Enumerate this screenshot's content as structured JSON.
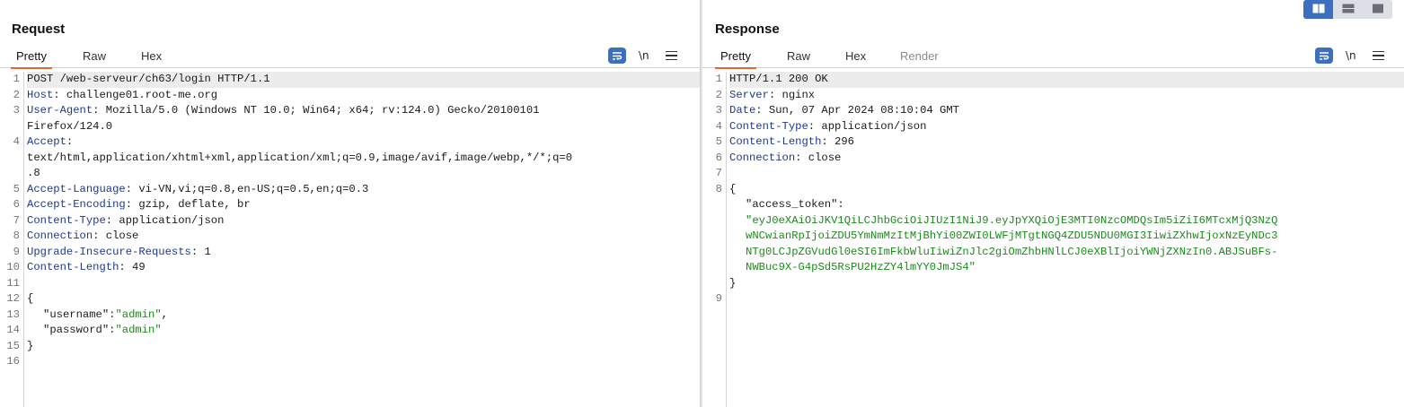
{
  "layout_toggle": {
    "buttons": [
      {
        "name": "side-by-side-layout-button",
        "icon": "columns-icon",
        "active": true
      },
      {
        "name": "stacked-layout-button",
        "icon": "rows-icon",
        "active": false
      },
      {
        "name": "single-layout-button",
        "icon": "square-icon",
        "active": false
      }
    ]
  },
  "request": {
    "title": "Request",
    "tabs": [
      "Pretty",
      "Raw",
      "Hex"
    ],
    "active_tab": "Pretty",
    "tools": {
      "wrap_icon": "wrap-text-icon",
      "newline_label": "\\n",
      "menu_icon": "hamburger-menu-icon"
    },
    "lines": [
      {
        "n": "1",
        "parts": [
          {
            "t": "POST /web-serveur/ch63/login HTTP/1.1",
            "c": "plain"
          }
        ],
        "highlight": true
      },
      {
        "n": "2",
        "parts": [
          {
            "t": "Host",
            "c": "hn"
          },
          {
            "t": ": challenge01.root-me.org",
            "c": "plain"
          }
        ]
      },
      {
        "n": "3",
        "parts": [
          {
            "t": "User-Agent",
            "c": "hn"
          },
          {
            "t": ": Mozilla/5.0 (Windows NT 10.0; Win64; x64; rv:124.0) Gecko/20100101",
            "c": "plain"
          }
        ]
      },
      {
        "n": "",
        "parts": [
          {
            "t": "Firefox/124.0",
            "c": "plain"
          }
        ]
      },
      {
        "n": "4",
        "parts": [
          {
            "t": "Accept",
            "c": "hn"
          },
          {
            "t": ":",
            "c": "plain"
          }
        ]
      },
      {
        "n": "",
        "parts": [
          {
            "t": "text/html,application/xhtml+xml,application/xml;q=0.9,image/avif,image/webp,*/*;q=0",
            "c": "plain"
          }
        ]
      },
      {
        "n": "",
        "parts": [
          {
            "t": ".8",
            "c": "plain"
          }
        ]
      },
      {
        "n": "5",
        "parts": [
          {
            "t": "Accept-Language",
            "c": "hn"
          },
          {
            "t": ": vi-VN,vi;q=0.8,en-US;q=0.5,en;q=0.3",
            "c": "plain"
          }
        ]
      },
      {
        "n": "6",
        "parts": [
          {
            "t": "Accept-Encoding",
            "c": "hn"
          },
          {
            "t": ": gzip, deflate, br",
            "c": "plain"
          }
        ]
      },
      {
        "n": "7",
        "parts": [
          {
            "t": "Content-Type",
            "c": "hn"
          },
          {
            "t": ": application/json",
            "c": "plain"
          }
        ]
      },
      {
        "n": "8",
        "parts": [
          {
            "t": "Connection",
            "c": "hn"
          },
          {
            "t": ": close",
            "c": "plain"
          }
        ]
      },
      {
        "n": "9",
        "parts": [
          {
            "t": "Upgrade-Insecure-Requests",
            "c": "hn"
          },
          {
            "t": ": 1",
            "c": "plain"
          }
        ]
      },
      {
        "n": "10",
        "parts": [
          {
            "t": "Content-Length",
            "c": "hn"
          },
          {
            "t": ": 49",
            "c": "plain"
          }
        ]
      },
      {
        "n": "11",
        "parts": []
      },
      {
        "n": "12",
        "parts": [
          {
            "t": "{",
            "c": "plain"
          }
        ]
      },
      {
        "n": "13",
        "indent": true,
        "parts": [
          {
            "t": "\"username\"",
            "c": "key"
          },
          {
            "t": ":",
            "c": "plain"
          },
          {
            "t": "\"admin\"",
            "c": "str"
          },
          {
            "t": ",",
            "c": "plain"
          }
        ]
      },
      {
        "n": "14",
        "indent": true,
        "parts": [
          {
            "t": "\"password\"",
            "c": "key"
          },
          {
            "t": ":",
            "c": "plain"
          },
          {
            "t": "\"admin\"",
            "c": "str"
          }
        ]
      },
      {
        "n": "15",
        "parts": [
          {
            "t": "}",
            "c": "plain"
          }
        ]
      },
      {
        "n": "16",
        "parts": []
      }
    ]
  },
  "response": {
    "title": "Response",
    "tabs": [
      "Pretty",
      "Raw",
      "Hex",
      "Render"
    ],
    "active_tab": "Pretty",
    "tools": {
      "wrap_icon": "wrap-text-icon",
      "newline_label": "\\n",
      "menu_icon": "hamburger-menu-icon"
    },
    "lines": [
      {
        "n": "1",
        "parts": [
          {
            "t": "HTTP/1.1 200 OK",
            "c": "plain"
          }
        ],
        "highlight": true
      },
      {
        "n": "2",
        "parts": [
          {
            "t": "Server",
            "c": "hn"
          },
          {
            "t": ": nginx",
            "c": "plain"
          }
        ]
      },
      {
        "n": "3",
        "parts": [
          {
            "t": "Date",
            "c": "hn"
          },
          {
            "t": ": Sun, 07 Apr 2024 08:10:04 GMT",
            "c": "plain"
          }
        ]
      },
      {
        "n": "4",
        "parts": [
          {
            "t": "Content-Type",
            "c": "hn"
          },
          {
            "t": ": application/json",
            "c": "plain"
          }
        ]
      },
      {
        "n": "5",
        "parts": [
          {
            "t": "Content-Length",
            "c": "hn"
          },
          {
            "t": ": 296",
            "c": "plain"
          }
        ]
      },
      {
        "n": "6",
        "parts": [
          {
            "t": "Connection",
            "c": "hn"
          },
          {
            "t": ": close",
            "c": "plain"
          }
        ]
      },
      {
        "n": "7",
        "parts": []
      },
      {
        "n": "8",
        "parts": [
          {
            "t": "{",
            "c": "plain"
          }
        ]
      },
      {
        "n": "",
        "indent": true,
        "parts": [
          {
            "t": "\"access_token\"",
            "c": "key"
          },
          {
            "t": ":",
            "c": "plain"
          }
        ]
      },
      {
        "n": "",
        "indent": true,
        "parts": [
          {
            "t": "\"eyJ0eXAiOiJKV1QiLCJhbGciOiJIUzI1NiJ9.eyJpYXQiOjE3MTI0NzcOMDQsIm5iZiI6MTcxMjQ3NzQ",
            "c": "str"
          }
        ]
      },
      {
        "n": "",
        "indent": true,
        "parts": [
          {
            "t": "wNCwianRpIjoiZDU5YmNmMzItMjBhYi00ZWI0LWFjMTgtNGQ4ZDU5NDU0MGI3IiwiZXhwIjoxNzEyNDc3",
            "c": "str"
          }
        ]
      },
      {
        "n": "",
        "indent": true,
        "parts": [
          {
            "t": "NTg0LCJpZGVudGl0eSI6ImFkbWluIiwiZnJlc2giOmZhbHNlLCJ0eXBlIjoiYWNjZXNzIn0.ABJSuBFs-",
            "c": "str"
          }
        ]
      },
      {
        "n": "",
        "indent": true,
        "parts": [
          {
            "t": "NWBuc9X-G4pSd5RsPU2HzZY4lmYY0JmJS4\"",
            "c": "str"
          }
        ]
      },
      {
        "n": "",
        "parts": [
          {
            "t": "}",
            "c": "plain"
          }
        ]
      },
      {
        "n": "9",
        "parts": []
      }
    ]
  }
}
